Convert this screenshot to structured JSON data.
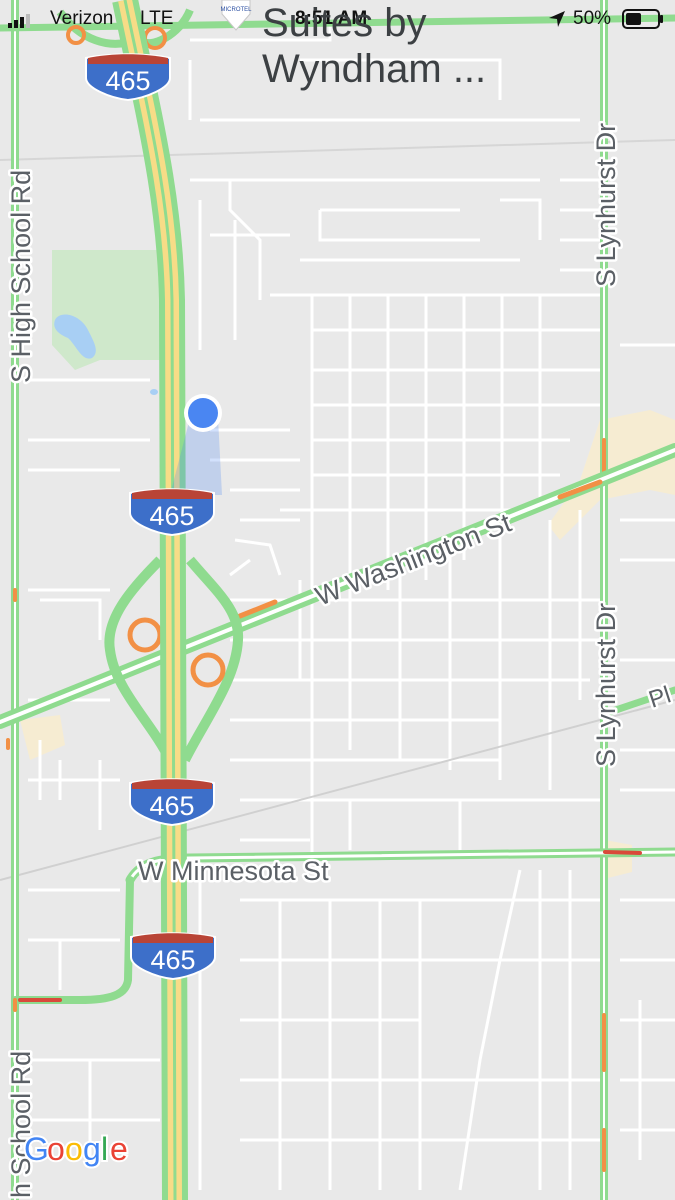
{
  "status_bar": {
    "carrier": "Verizon",
    "network": "LTE",
    "time": "8:51 AM",
    "battery": "50%"
  },
  "poi": {
    "name_line1": "Suites by",
    "name_line2": "Wyndham ...",
    "marker_text": "MICROTEL"
  },
  "roads": {
    "highway_shield": "465",
    "w_washington": "W Washington St",
    "w_minnesota": "W Minnesota St",
    "s_high_school_top": "S High School Rd",
    "s_high_school_bottom": "h School Rd",
    "s_lynhurst_top": "S Lynhurst Dr",
    "s_lynhurst_bottom": "S Lynhurst Dr",
    "partial_right": "Pl"
  },
  "attribution": {
    "g1": "G",
    "g2": "o",
    "g3": "o",
    "g4": "g",
    "g5": "l",
    "g6": "e"
  },
  "colors": {
    "background": "#e9e9e9",
    "traffic_green": "#8fdb8f",
    "traffic_orange": "#f29045",
    "traffic_red": "#d94a3a",
    "highway_yellow": "#f7dc87",
    "shield_blue": "#3d6fc9",
    "shield_red": "#b94436",
    "location_blue": "#4a86f2",
    "park_green": "#cfe8cb",
    "water_blue": "#a8cff4"
  },
  "icons": [
    "signal-bars-icon",
    "location-arrow-icon",
    "battery-icon",
    "my-location-dot-icon",
    "poi-marker-icon",
    "interstate-shield-icon"
  ]
}
